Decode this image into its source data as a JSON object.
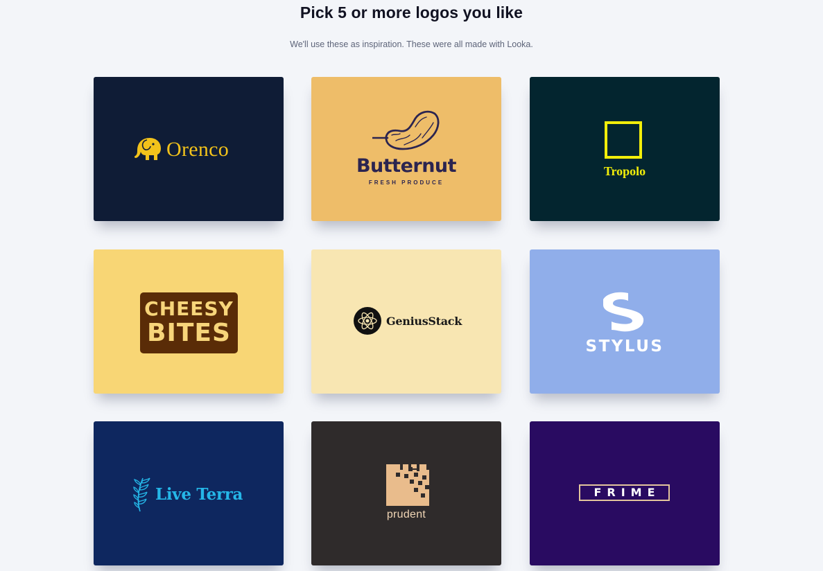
{
  "header": {
    "title": "Pick 5 or more logos you like",
    "subtitle": "We'll use these as inspiration. These were all made with Looka."
  },
  "logos": [
    {
      "name": "Orenco",
      "tagline": "",
      "bg": "#0f1c36",
      "accent": "#f2c21b",
      "icon": "elephant-icon"
    },
    {
      "name": "Butternut",
      "tagline": "FRESH PRODUCE",
      "bg": "#eebd69",
      "accent": "#2b2450",
      "icon": "squash-icon"
    },
    {
      "name": "Tropolo",
      "tagline": "",
      "bg": "#03252f",
      "accent": "#f2ee0a",
      "icon": "square-outline-icon"
    },
    {
      "name_line1": "CHEESY",
      "name_line2": "BITES",
      "bg": "#f8d675",
      "accent": "#5a2c07",
      "icon": ""
    },
    {
      "name": "GeniusStack",
      "bg": "#f8e6b2",
      "accent": "#1a1a1a",
      "icon": "atom-icon"
    },
    {
      "name": "STYLUS",
      "bg": "#90aeea",
      "accent": "#ffffff",
      "icon": "s-letter-icon"
    },
    {
      "name": "Live Terra",
      "bg": "#0e275f",
      "accent": "#25b7e8",
      "icon": "leaf-icon"
    },
    {
      "name": "prudent",
      "bg": "#2f2b2b",
      "accent": "#e9bc8c",
      "icon": "pixel-block-icon"
    },
    {
      "name": "FRIME",
      "bg": "#290b61",
      "accent": "#e3c59c",
      "icon": ""
    }
  ]
}
